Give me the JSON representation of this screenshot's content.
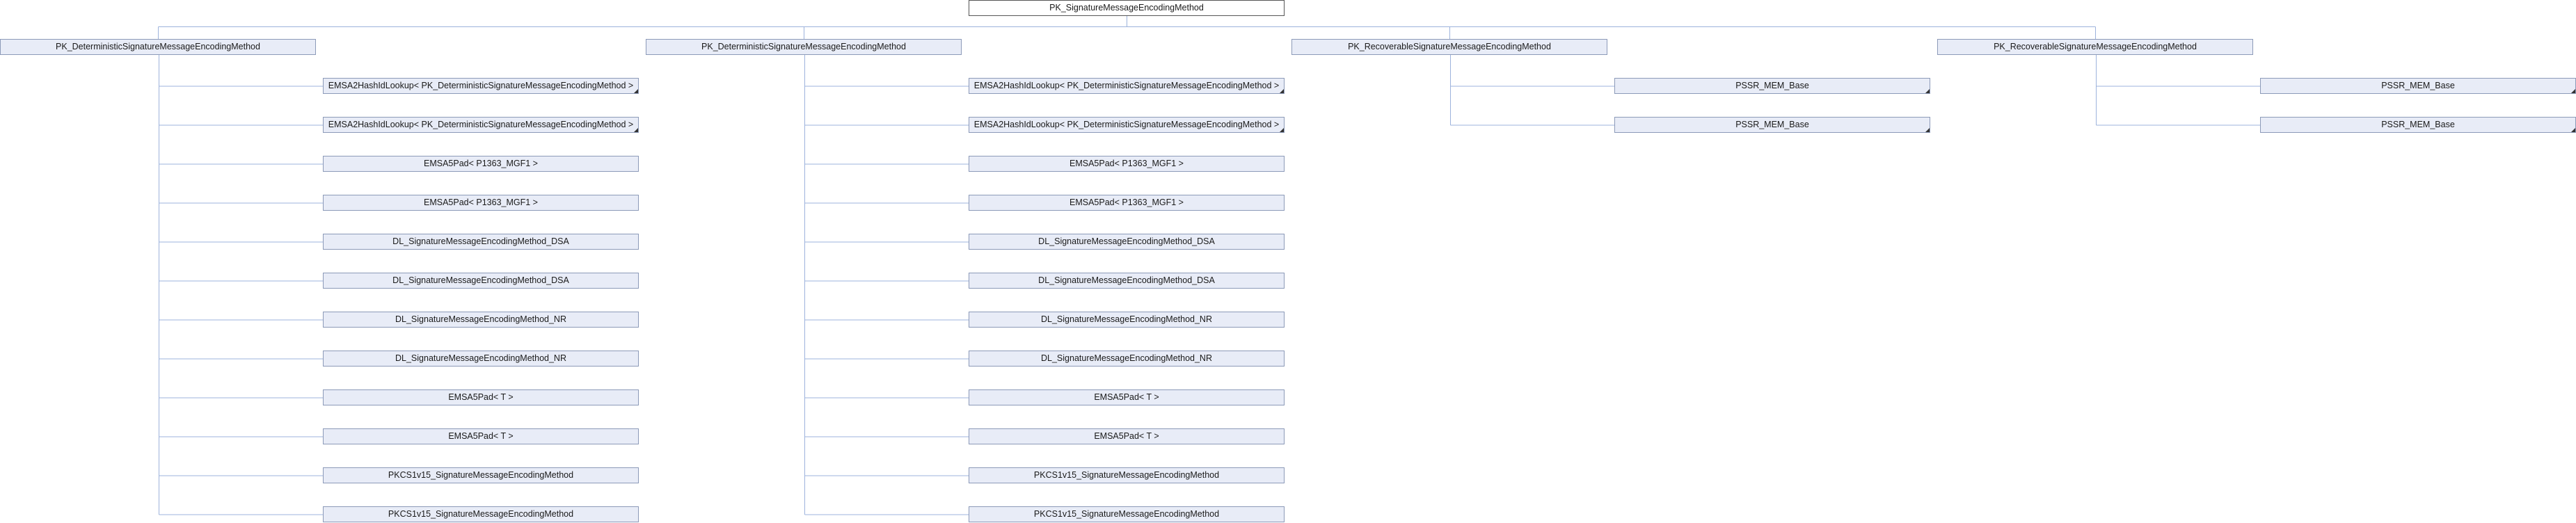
{
  "root": {
    "label": "PK_SignatureMessageEncodingMethod"
  },
  "groups": [
    {
      "label": "PK_DeterministicSignatureMessageEncodingMethod",
      "children": [
        {
          "label": "EMSA2HashIdLookup< PK_DeterministicSignatureMessageEncodingMethod >",
          "truncated": true
        },
        {
          "label": "EMSA2HashIdLookup< PK_DeterministicSignatureMessageEncodingMethod >",
          "truncated": true
        },
        {
          "label": "EMSA5Pad< P1363_MGF1 >",
          "truncated": false
        },
        {
          "label": "EMSA5Pad< P1363_MGF1 >",
          "truncated": false
        },
        {
          "label": "DL_SignatureMessageEncodingMethod_DSA",
          "truncated": false
        },
        {
          "label": "DL_SignatureMessageEncodingMethod_DSA",
          "truncated": false
        },
        {
          "label": "DL_SignatureMessageEncodingMethod_NR",
          "truncated": false
        },
        {
          "label": "DL_SignatureMessageEncodingMethod_NR",
          "truncated": false
        },
        {
          "label": "EMSA5Pad< T >",
          "truncated": false
        },
        {
          "label": "EMSA5Pad< T >",
          "truncated": false
        },
        {
          "label": "PKCS1v15_SignatureMessageEncodingMethod",
          "truncated": false
        },
        {
          "label": "PKCS1v15_SignatureMessageEncodingMethod",
          "truncated": false
        }
      ]
    },
    {
      "label": "PK_DeterministicSignatureMessageEncodingMethod",
      "children": [
        {
          "label": "EMSA2HashIdLookup< PK_DeterministicSignatureMessageEncodingMethod >",
          "truncated": true
        },
        {
          "label": "EMSA2HashIdLookup< PK_DeterministicSignatureMessageEncodingMethod >",
          "truncated": true
        },
        {
          "label": "EMSA5Pad< P1363_MGF1 >",
          "truncated": false
        },
        {
          "label": "EMSA5Pad< P1363_MGF1 >",
          "truncated": false
        },
        {
          "label": "DL_SignatureMessageEncodingMethod_DSA",
          "truncated": false
        },
        {
          "label": "DL_SignatureMessageEncodingMethod_DSA",
          "truncated": false
        },
        {
          "label": "DL_SignatureMessageEncodingMethod_NR",
          "truncated": false
        },
        {
          "label": "DL_SignatureMessageEncodingMethod_NR",
          "truncated": false
        },
        {
          "label": "EMSA5Pad< T >",
          "truncated": false
        },
        {
          "label": "EMSA5Pad< T >",
          "truncated": false
        },
        {
          "label": "PKCS1v15_SignatureMessageEncodingMethod",
          "truncated": false
        },
        {
          "label": "PKCS1v15_SignatureMessageEncodingMethod",
          "truncated": false
        }
      ]
    },
    {
      "label": "PK_RecoverableSignatureMessageEncodingMethod",
      "children": [
        {
          "label": "PSSR_MEM_Base",
          "truncated": true
        },
        {
          "label": "PSSR_MEM_Base",
          "truncated": true
        }
      ]
    },
    {
      "label": "PK_RecoverableSignatureMessageEncodingMethod",
      "children": [
        {
          "label": "PSSR_MEM_Base",
          "truncated": true
        },
        {
          "label": "PSSR_MEM_Base",
          "truncated": true
        }
      ]
    }
  ],
  "colors": {
    "node_fill": "#e8ecf7",
    "node_border": "#8c9ab8",
    "edge": "#9db3dc",
    "root_border": "#555555"
  }
}
